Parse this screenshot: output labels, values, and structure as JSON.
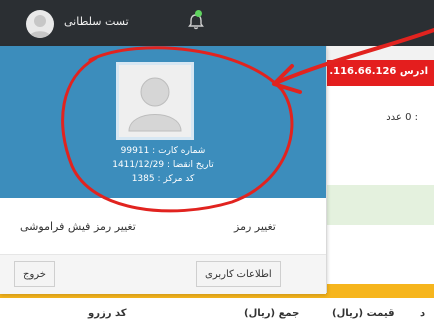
{
  "navbar": {
    "user_name": "تست سلطانی",
    "bell_icon": "bell-icon"
  },
  "background": {
    "ip_text": ".116.66.126 ادرس",
    "count_text": ": 0 عدد",
    "table_headers": [
      "کد رزرو",
      "جمع (ریال)",
      "قیمت (ریال)",
      "د"
    ]
  },
  "dropdown": {
    "card_number": "شماره کارت : 99911",
    "expiry": "تاریخ انقضا : 1411/12/29",
    "center_code": "کد مرکز : 1385",
    "links": {
      "change_password": "تغییر رمز",
      "change_forgotten_receipt_password": "تغییر رمز فیش فراموشی"
    },
    "buttons": {
      "user_info": "اطلاعات کاربری",
      "logout": "خروج"
    }
  },
  "colors": {
    "navbar": "#2b2f33",
    "header_blue": "#3c8dbc",
    "annotation_red": "#e1231f",
    "accent_orange": "#f6b51d"
  }
}
